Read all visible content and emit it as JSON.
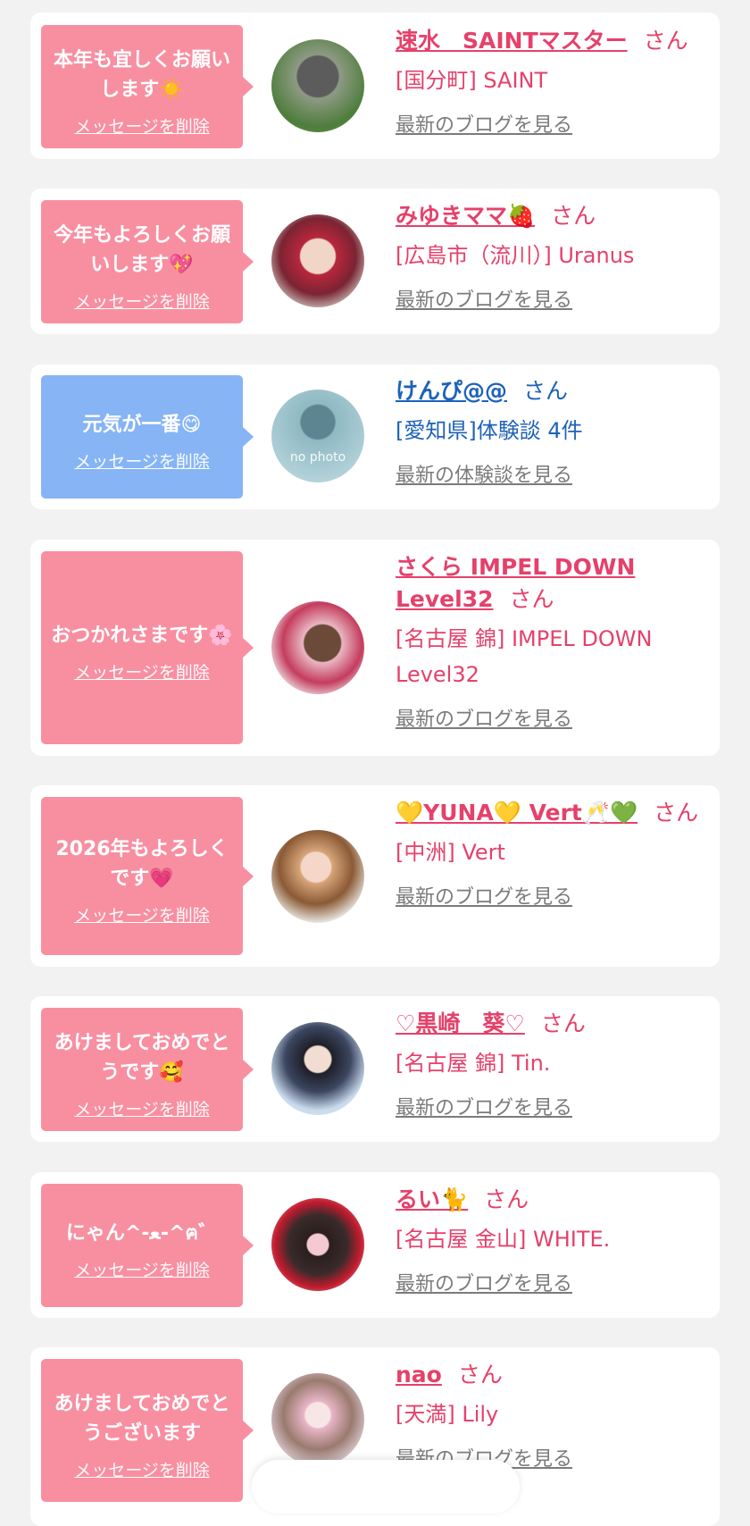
{
  "items": [
    {
      "message": "本年も宜しくお願いします☀️",
      "delete_label": "メッセージを削除",
      "name": "速水　SAINTマスター",
      "san": "さん",
      "shop": "[国分町] SAINT",
      "blog": "最新のブログを見る",
      "theme": "pink"
    },
    {
      "message": "今年もよろしくお願いします💖",
      "delete_label": "メッセージを削除",
      "name": "みゆきママ🍓",
      "san": "さん",
      "shop": "[広島市（流川）] Uranus",
      "blog": "最新のブログを見る",
      "theme": "pink"
    },
    {
      "message": "元気が一番😋",
      "delete_label": "メッセージを削除",
      "name": "けんぴ@@",
      "san": "さん",
      "shop": "[愛知県]体験談 4件",
      "blog": "最新の体験談を見る",
      "theme": "blue",
      "avatar_text": "no photo"
    },
    {
      "message": "おつかれさまです🌸",
      "delete_label": "メッセージを削除",
      "name": "さくら IMPEL DOWN Level32",
      "san": "さん",
      "shop": "[名古屋 錦] IMPEL DOWN Level32",
      "blog": "最新のブログを見る",
      "theme": "pink"
    },
    {
      "message": "2026年もよろしくです💗",
      "delete_label": "メッセージを削除",
      "name": "💛YUNA💛 Vert🥂💚",
      "san": "さん",
      "shop": "[中洲] Vert",
      "blog": "最新のブログを見る",
      "theme": "pink"
    },
    {
      "message": "あけましておめでとうです🥰",
      "delete_label": "メッセージを削除",
      "name": "♡黒崎　葵♡",
      "san": "さん",
      "shop": "[名古屋 錦] Tin.",
      "blog": "最新のブログを見る",
      "theme": "pink"
    },
    {
      "message": "にゃん^-ﻌ-^ฅ゛",
      "delete_label": "メッセージを削除",
      "name": "るい🐈",
      "san": "さん",
      "shop": "[名古屋 金山] WHITE.",
      "blog": "最新のブログを見る",
      "theme": "pink"
    },
    {
      "message": "あけましておめでとうございます",
      "delete_label": "メッセージを削除",
      "name": "nao",
      "san": "さん",
      "shop": "[天満] Lily",
      "blog": "最新のブログを見る",
      "theme": "pink"
    }
  ],
  "colors": {
    "pink_bubble": "#f88fa1",
    "blue_bubble": "#86b4f5",
    "name_pink": "#e5416a",
    "name_blue": "#1d62b8",
    "link_gray": "#7b7b7b"
  }
}
